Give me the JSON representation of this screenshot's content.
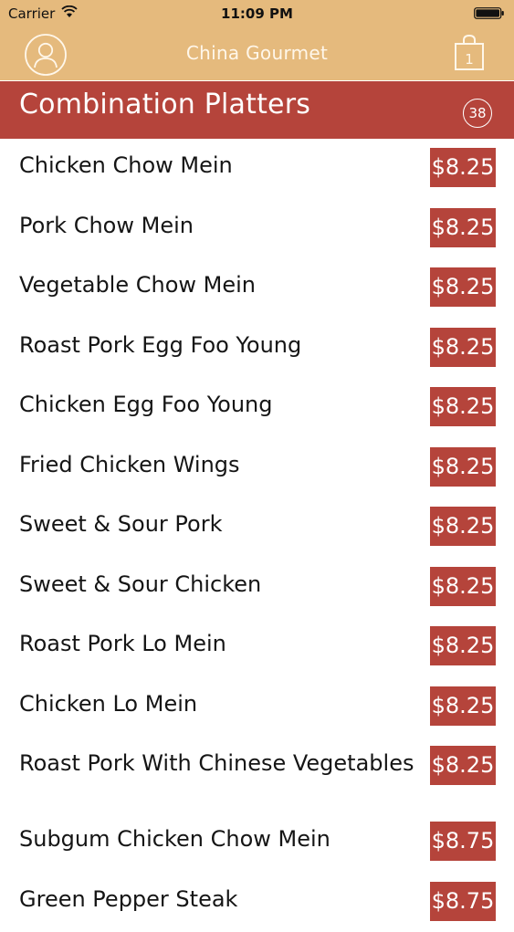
{
  "status_bar": {
    "carrier": "Carrier",
    "time": "11:09 PM"
  },
  "nav": {
    "title": "China Gourmet",
    "profile_icon": "user-icon",
    "cart_icon": "shopping-bag-icon",
    "cart_count": "1"
  },
  "category": {
    "title": "Combination Platters",
    "count": "38"
  },
  "colors": {
    "nav_bg": "#e5ba7d",
    "accent": "#b5443b"
  },
  "items": [
    {
      "name": "Chicken Chow Mein",
      "price": "$8.25"
    },
    {
      "name": "Pork Chow Mein",
      "price": "$8.25"
    },
    {
      "name": "Vegetable Chow Mein",
      "price": "$8.25"
    },
    {
      "name": "Roast Pork Egg Foo Young",
      "price": "$8.25"
    },
    {
      "name": "Chicken Egg Foo Young",
      "price": "$8.25"
    },
    {
      "name": "Fried Chicken Wings",
      "price": "$8.25"
    },
    {
      "name": "Sweet & Sour Pork",
      "price": "$8.25"
    },
    {
      "name": "Sweet & Sour Chicken",
      "price": "$8.25"
    },
    {
      "name": "Roast Pork Lo Mein",
      "price": "$8.25"
    },
    {
      "name": "Chicken Lo Mein",
      "price": "$8.25"
    },
    {
      "name": "Roast Pork With Chinese Vegetables",
      "price": "$8.25"
    },
    {
      "name": "Subgum Chicken Chow Mein",
      "price": "$8.75"
    },
    {
      "name": "Green Pepper Steak",
      "price": "$8.75"
    }
  ]
}
